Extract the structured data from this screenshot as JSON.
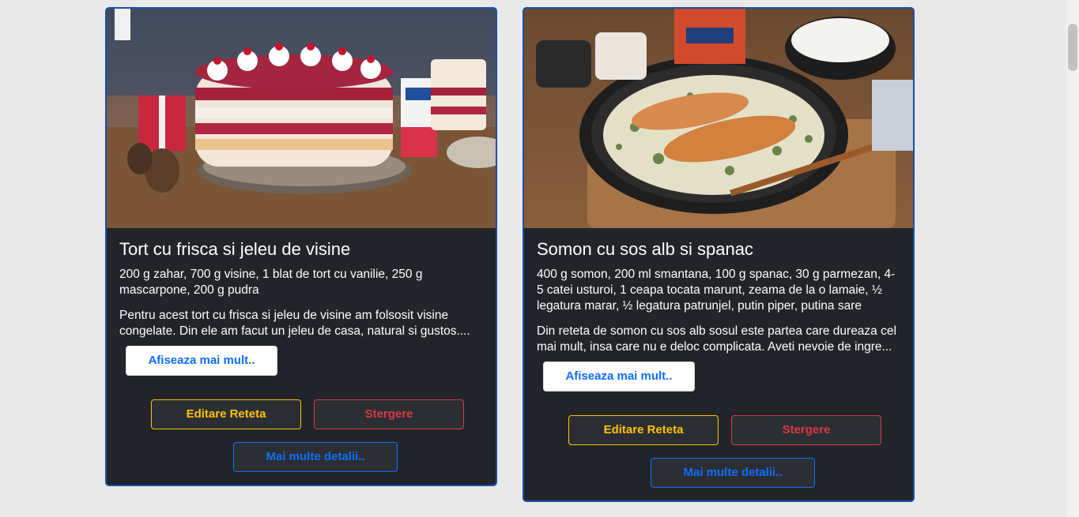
{
  "recipes": [
    {
      "title": "Tort cu frisca si jeleu de visine",
      "ingredients": "200 g zahar, 700 g visine, 1 blat de tort cu vanilie, 250 g mascarpone, 200 g pudra",
      "description": "Pentru acest tort cu frisca si jeleu de visine am folsosit visine congelate. Din ele am facut un jeleu de casa, natural si gustos....",
      "show_more": "Afiseaza mai mult..",
      "edit": "Editare Reteta",
      "delete": "Stergere",
      "details": "Mai multe detalii.."
    },
    {
      "title": "Somon cu sos alb si spanac",
      "ingredients": "400 g somon, 200 ml smantana, 100 g spanac, 30 g parmezan, 4-5 catei usturoi, 1 ceapa tocata marunt, zeama de la o lamaie, ½ legatura marar, ½ legatura patrunjel, putin piper, putina sare",
      "description": "Din reteta de somon cu sos alb sosul este partea care dureaza cel mai mult, insa care nu e deloc complicata. Aveti nevoie de ingre...",
      "show_more": "Afiseaza mai mult..",
      "edit": "Editare Reteta",
      "delete": "Stergere",
      "details": "Mai multe detalii.."
    }
  ],
  "colors": {
    "card_bg": "#212529",
    "card_border": "#1a4fa8",
    "edit": "#ffc107",
    "delete": "#dc3545",
    "primary": "#0d6efd"
  }
}
